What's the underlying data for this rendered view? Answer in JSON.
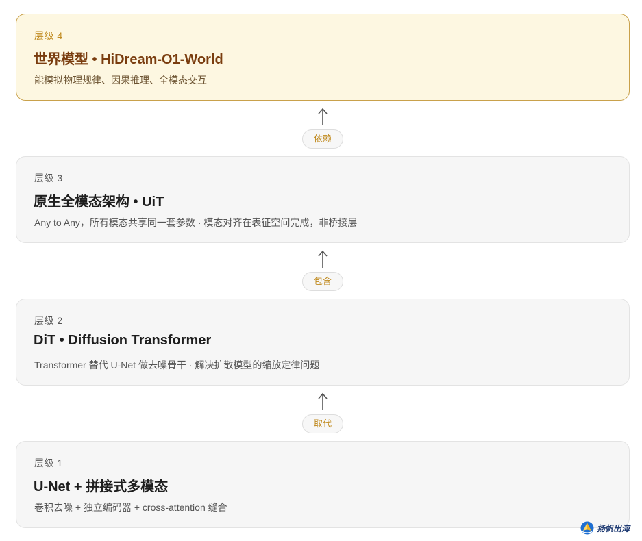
{
  "layers": [
    {
      "level": "层级 4",
      "title": "世界模型 • HiDream-O1-World",
      "desc": "能模拟物理规律、因果推理、全模态交互"
    },
    {
      "level": "层级 3",
      "title": "原生全模态架构 • UiT",
      "desc": "Any to Any，所有模态共享同一套参数 · 模态对齐在表征空间完成，非桥接层"
    },
    {
      "level": "层级 2",
      "title": "DiT • Diffusion Transformer",
      "desc": "Transformer 替代 U-Net 做去噪骨干 · 解决扩散模型的缩放定律问题"
    },
    {
      "level": "层级 1",
      "title": "U-Net + 拼接式多模态",
      "desc": "卷积去噪 + 独立编码器 + cross-attention 缝合"
    }
  ],
  "relations": [
    "依赖",
    "包含",
    "取代"
  ],
  "watermark": "扬帆出海",
  "colors": {
    "highlight_bg": "#fdf7e1",
    "highlight_border": "#c9a14b",
    "highlight_title": "#7a3d0f",
    "accent": "#c08a1e",
    "card_bg": "#f6f6f6"
  }
}
